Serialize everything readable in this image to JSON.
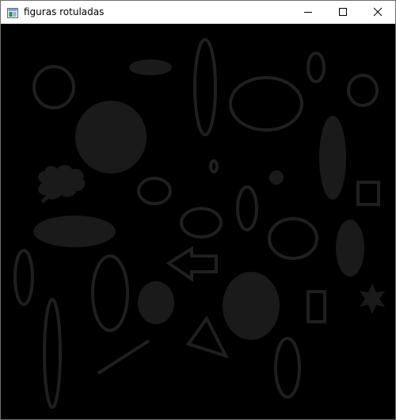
{
  "window": {
    "title": "figuras rotuladas",
    "app_icon": "window-app-icon",
    "controls": {
      "minimize_icon": "minimize-icon",
      "maximize_icon": "maximize-icon",
      "close_icon": "close-icon"
    }
  },
  "canvas": {
    "background_color": "#000000",
    "shape_fill_color": "#1a1a1a",
    "shape_stroke_color": "#1f1f1f",
    "label_text_visible": false
  }
}
